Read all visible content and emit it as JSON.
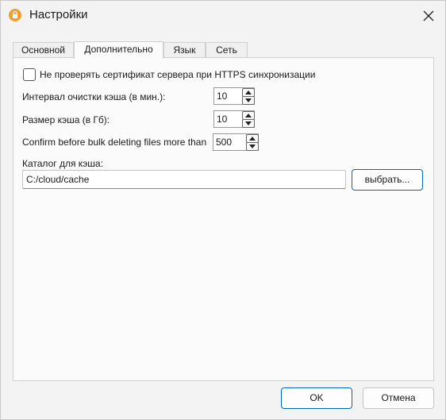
{
  "window": {
    "title": "Настройки",
    "app_icon": "lock-app-icon",
    "close_icon": "close-icon"
  },
  "tabs": [
    {
      "label": "Основной",
      "active": false
    },
    {
      "label": "Дополнительно",
      "active": true
    },
    {
      "label": "Язык",
      "active": false
    },
    {
      "label": "Сеть",
      "active": false
    }
  ],
  "advanced": {
    "skip_cert_check": {
      "label": "Не проверять сертификат сервера при HTTPS синхронизации",
      "checked": false
    },
    "cache_clean_interval": {
      "label": "Интервал очистки кэша (в мин.):",
      "value": "10"
    },
    "cache_size": {
      "label": "Размер кэша (в Гб):",
      "value": "10"
    },
    "bulk_delete_confirm": {
      "label": "Confirm before bulk deleting files more than",
      "value": "500"
    },
    "cache_dir": {
      "label": "Каталог для кэша:",
      "value": "C:/cloud/cache",
      "browse_label": "выбрать..."
    }
  },
  "footer": {
    "ok_label": "OK",
    "cancel_label": "Отмена"
  },
  "colors": {
    "accent": "#0067c0",
    "background": "#f3f3f3",
    "panel": "#fbfbfb"
  }
}
